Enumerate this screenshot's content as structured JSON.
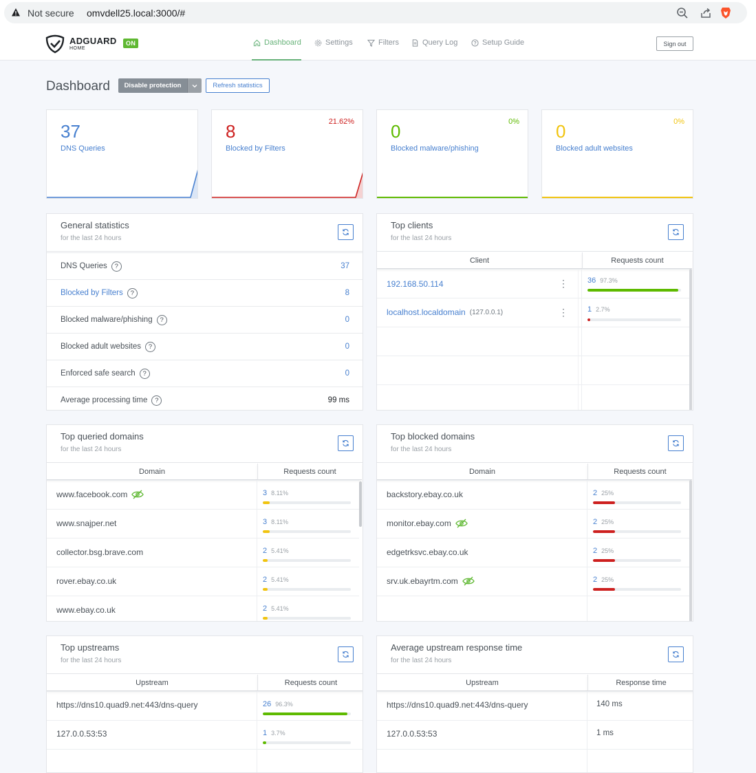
{
  "browser": {
    "security": "Not secure",
    "url": "omvdell25.local:3000/#"
  },
  "header": {
    "brand": "ADGUARD",
    "brand_sub": "HOME",
    "status": "ON",
    "nav": [
      {
        "label": "Dashboard",
        "icon": "home-icon",
        "active": true
      },
      {
        "label": "Settings",
        "icon": "gear-icon"
      },
      {
        "label": "Filters",
        "icon": "filter-icon"
      },
      {
        "label": "Query Log",
        "icon": "document-icon"
      },
      {
        "label": "Setup Guide",
        "icon": "help-icon"
      }
    ],
    "sign_out": "Sign out"
  },
  "toolbar": {
    "title": "Dashboard",
    "disable": "Disable protection",
    "refresh": "Refresh statistics"
  },
  "stats": [
    {
      "value": "37",
      "label": "DNS Queries",
      "pct": "",
      "color": "#467fcf"
    },
    {
      "value": "8",
      "label": "Blocked by Filters",
      "pct": "21.62%",
      "color": "#cd201f"
    },
    {
      "value": "0",
      "label": "Blocked malware/phishing",
      "pct": "0%",
      "color": "#5eba00"
    },
    {
      "value": "0",
      "label": "Blocked adult websites",
      "pct": "0%",
      "color": "#f1c40f"
    }
  ],
  "general": {
    "title": "General statistics",
    "sub": "for the last 24 hours",
    "rows": [
      {
        "label": "DNS Queries",
        "value": "37"
      },
      {
        "label": "Blocked by Filters",
        "value": "8"
      },
      {
        "label": "Blocked malware/phishing",
        "value": "0"
      },
      {
        "label": "Blocked adult websites",
        "value": "0"
      },
      {
        "label": "Enforced safe search",
        "value": "0"
      },
      {
        "label": "Average processing time",
        "value": "99 ms"
      }
    ]
  },
  "clients": {
    "title": "Top clients",
    "sub": "for the last 24 hours",
    "col1": "Client",
    "col2": "Requests count",
    "rows": [
      {
        "name": "192.168.50.114",
        "extra": "",
        "count": "36",
        "pct": "97.3%",
        "fill": 0.973
      },
      {
        "name": "localhost.localdomain",
        "extra": "(127.0.0.1)",
        "count": "1",
        "pct": "2.7%",
        "fill": 0.027
      }
    ]
  },
  "queried": {
    "title": "Top queried domains",
    "sub": "for the last 24 hours",
    "col1": "Domain",
    "col2": "Requests count",
    "rows": [
      {
        "name": "www.facebook.com",
        "tracker": true,
        "count": "3",
        "pct": "8.11%",
        "fill": 0.0811
      },
      {
        "name": "www.snajper.net",
        "tracker": false,
        "count": "3",
        "pct": "8.11%",
        "fill": 0.0811
      },
      {
        "name": "collector.bsg.brave.com",
        "tracker": false,
        "count": "2",
        "pct": "5.41%",
        "fill": 0.0541
      },
      {
        "name": "rover.ebay.co.uk",
        "tracker": false,
        "count": "2",
        "pct": "5.41%",
        "fill": 0.0541
      },
      {
        "name": "www.ebay.co.uk",
        "tracker": false,
        "count": "2",
        "pct": "5.41%",
        "fill": 0.0541
      }
    ]
  },
  "blocked": {
    "title": "Top blocked domains",
    "sub": "for the last 24 hours",
    "col1": "Domain",
    "col2": "Requests count",
    "rows": [
      {
        "name": "backstory.ebay.co.uk",
        "tracker": false,
        "count": "2",
        "pct": "25%",
        "fill": 0.25
      },
      {
        "name": "monitor.ebay.com",
        "tracker": true,
        "count": "2",
        "pct": "25%",
        "fill": 0.25
      },
      {
        "name": "edgetrksvc.ebay.co.uk",
        "tracker": false,
        "count": "2",
        "pct": "25%",
        "fill": 0.25
      },
      {
        "name": "srv.uk.ebayrtm.com",
        "tracker": true,
        "count": "2",
        "pct": "25%",
        "fill": 0.25
      }
    ]
  },
  "upstreams": {
    "title": "Top upstreams",
    "sub": "for the last 24 hours",
    "col1": "Upstream",
    "col2": "Requests count",
    "rows": [
      {
        "name": "https://dns10.quad9.net:443/dns-query",
        "count": "26",
        "pct": "96.3%",
        "fill": 0.963
      },
      {
        "name": "127.0.0.53:53",
        "count": "1",
        "pct": "3.7%",
        "fill": 0.037
      }
    ]
  },
  "response": {
    "title": "Average upstream response time",
    "sub": "for the last 24 hours",
    "col1": "Upstream",
    "col2": "Response time",
    "rows": [
      {
        "name": "https://dns10.quad9.net:443/dns-query",
        "time": "140 ms"
      },
      {
        "name": "127.0.0.53:53",
        "time": "1 ms"
      }
    ]
  },
  "colors": {
    "blue": "#467fcf",
    "green": "#5eba00",
    "red": "#cd201f",
    "yellow": "#f1c40f"
  }
}
